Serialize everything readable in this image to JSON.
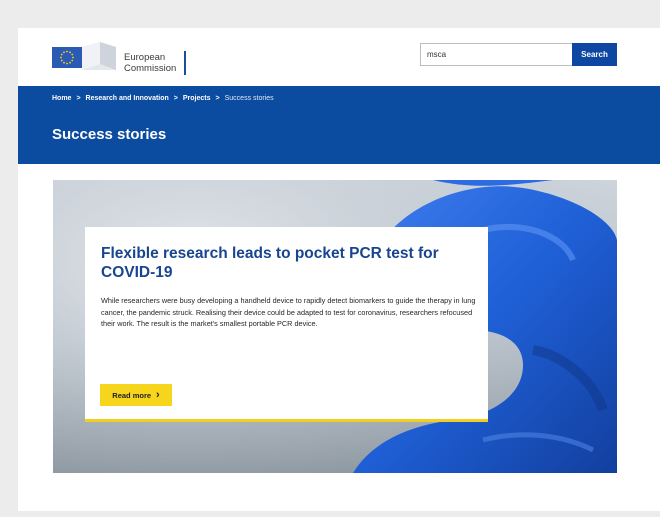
{
  "header": {
    "logo": {
      "line1": "European",
      "line2": "Commission"
    },
    "search": {
      "value": "msca",
      "button_label": "Search"
    }
  },
  "breadcrumb": {
    "items": [
      "Home",
      "Research and Innovation",
      "Projects",
      "Success stories"
    ],
    "separator": ">"
  },
  "page_title": "Success stories",
  "hero": {
    "title": "Flexible research leads to pocket PCR test for COVID-19",
    "body": "While researchers were busy developing a handheld device to rapidly detect biomarkers to guide the therapy in lung cancer, the pandemic struck. Realising their device could be adapted to test for coronavirus, researchers refocused their work. The result is the market's smallest portable PCR device.",
    "cta_label": "Read more",
    "cta_icon": "chevron-right-icon"
  },
  "colors": {
    "brand_blue": "#0b4ca0",
    "title_blue": "#17458f",
    "accent_yellow": "#f7d51d",
    "glove_blue": "#1f5fd6"
  }
}
